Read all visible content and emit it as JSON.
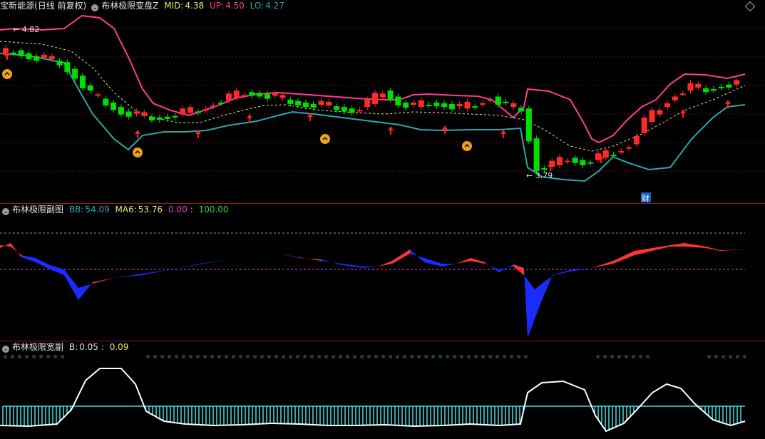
{
  "main": {
    "stock_name": "宝新能源",
    "period": "(日线 前复权)",
    "indicator": "布林极限变盘Z",
    "mid_label": "MID:",
    "mid_value": "4.38",
    "up_label": "UP:",
    "up_value": "4.50",
    "lo_label": "LO:",
    "lo_value": "4.27",
    "high_marker": "4.82",
    "low_marker": "3.79",
    "cai_badge": "财"
  },
  "sub1": {
    "title": "布林极限副图",
    "bb_label": "BB:",
    "bb_value": "54.09",
    "ma6_label": "MA6:",
    "ma6_value": "53.76",
    "level_a": "0.00",
    "level_b": "100.00"
  },
  "sub2": {
    "title": "布林极限宽副",
    "b_label": "B:",
    "b_value": "0.05",
    "c_value": "0.09"
  },
  "colors": {
    "up": "#ff2a2a",
    "down": "#00e000",
    "upper": "#ff3c96",
    "lower": "#2aa8a8",
    "mid": "#e8e870",
    "bb": "#ff3333",
    "ma6": "#1a2cff",
    "width": "#ffffff",
    "bars": "#40e0e0",
    "sig": "#44cc44"
  },
  "chart_data": [
    {
      "type": "candlestick",
      "name": "布林极限变盘Z",
      "price_markers": {
        "high": 4.82,
        "low": 3.79
      },
      "summary": {
        "mid": 4.38,
        "up": 4.5,
        "lo": 4.27
      },
      "trend_points": [
        4.66,
        4.69,
        4.65,
        4.63,
        4.61,
        4.52,
        4.39,
        4.34,
        4.28,
        4.25,
        4.24,
        4.25,
        4.27,
        4.29,
        4.34,
        4.37,
        4.41,
        4.4,
        4.37,
        4.35,
        4.33,
        4.32,
        4.31,
        4.29,
        4.33,
        4.42,
        4.34,
        4.31,
        4.34,
        4.33,
        4.3,
        4.33,
        4.38,
        4.31,
        4.3,
        3.9,
        3.92,
        3.97,
        3.94,
        3.97,
        4.01,
        4.06,
        4.21,
        4.31,
        4.4,
        4.44,
        4.43,
        4.46
      ]
    },
    {
      "type": "area",
      "name": "布林极限副图",
      "series": [
        {
          "name": "BB",
          "value": 54.09
        },
        {
          "name": "MA6",
          "value": 53.76
        }
      ],
      "levels": [
        0.0,
        100.0
      ]
    },
    {
      "type": "line",
      "name": "布林极限宽副",
      "series": [
        {
          "name": "B",
          "value": 0.05
        }
      ],
      "extra": 0.09
    }
  ]
}
